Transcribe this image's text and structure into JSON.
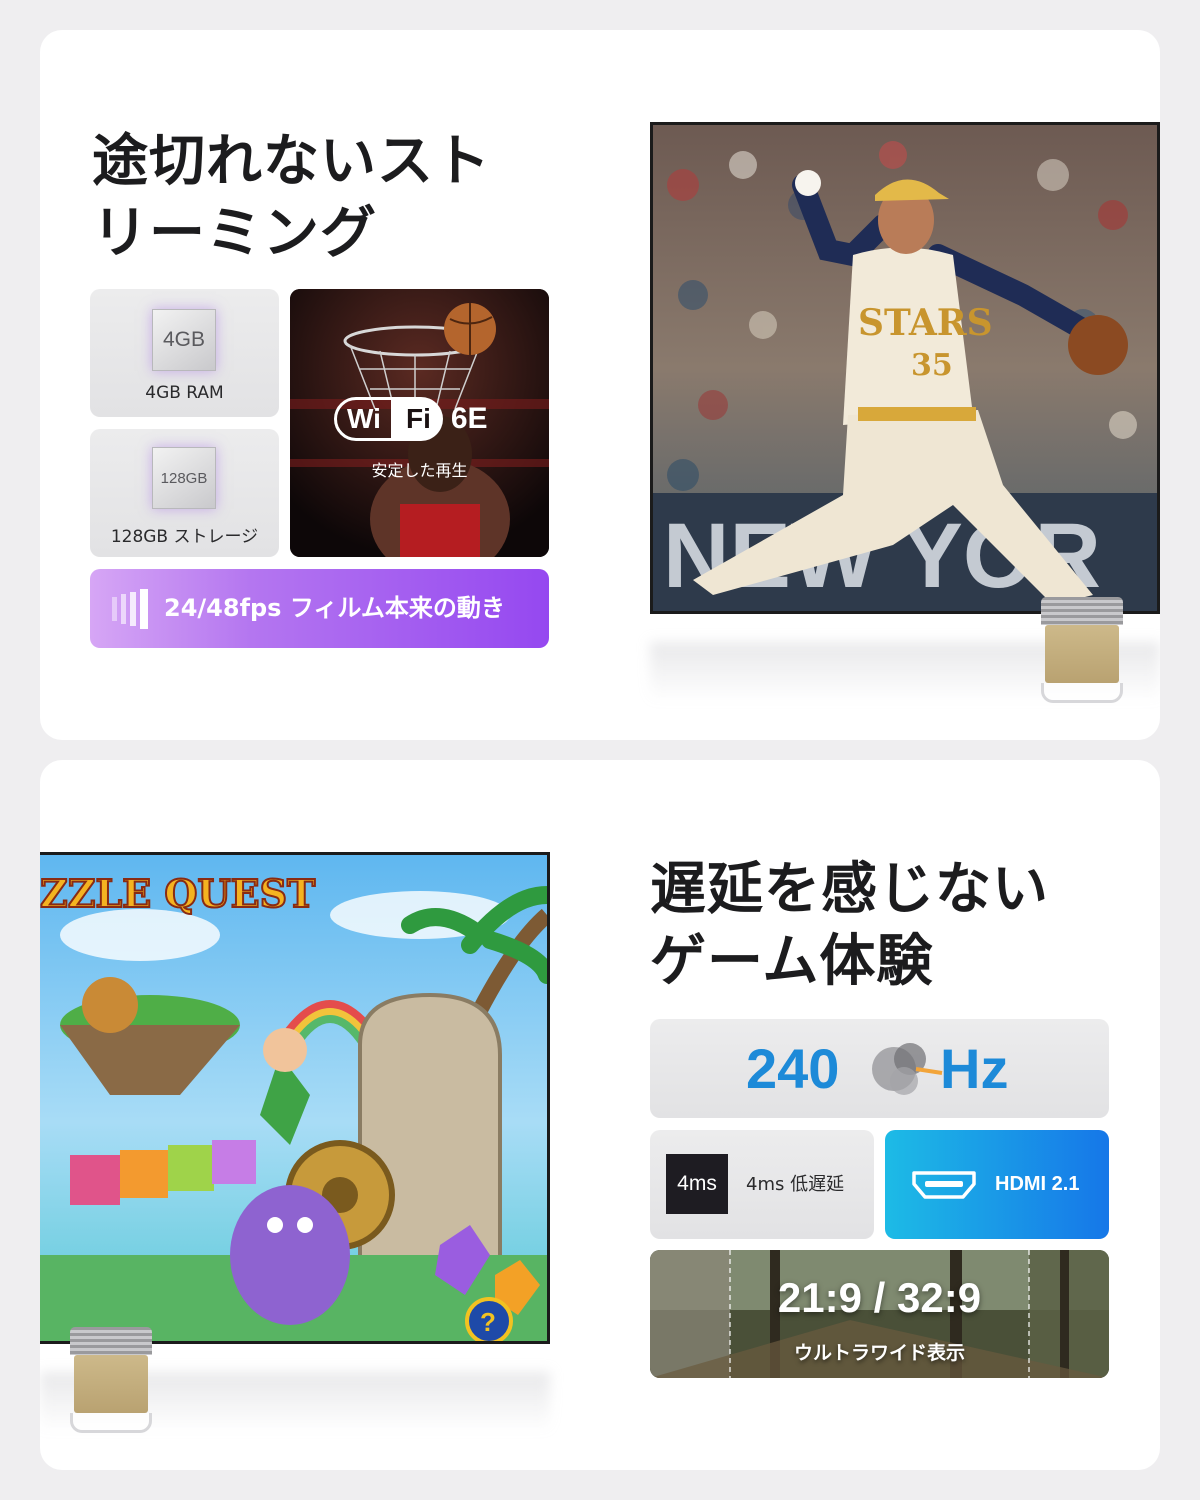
{
  "streaming": {
    "title_line1": "途切れないスト",
    "title_line2": "リーミング",
    "ram_chip": "4GB",
    "ram_label": "4GB RAM",
    "storage_chip": "128GB",
    "storage_label": "128GB ストレージ",
    "wifi_word1": "Wi",
    "wifi_word2": "Fi",
    "wifi_version": "6E",
    "wifi_sub": "安定した再生",
    "fps_label": "24/48fps フィルム本来の動き",
    "pitcher_team": "STARS",
    "pitcher_number": "35",
    "banner_text": "NEW YOR"
  },
  "gaming": {
    "title_line1": "遅延を感じない",
    "title_line2": "ゲーム体験",
    "refresh_value": "240",
    "refresh_unit": "Hz",
    "latency_chip": "4ms",
    "latency_label": "4ms 低遅延",
    "hdmi_label": "HDMI 2.1",
    "ratio_value": "21:9 / 32:9",
    "ratio_sub": "ウルトラワイド表示",
    "game_title": "ZZLE QUEST",
    "help_glyph": "?"
  }
}
